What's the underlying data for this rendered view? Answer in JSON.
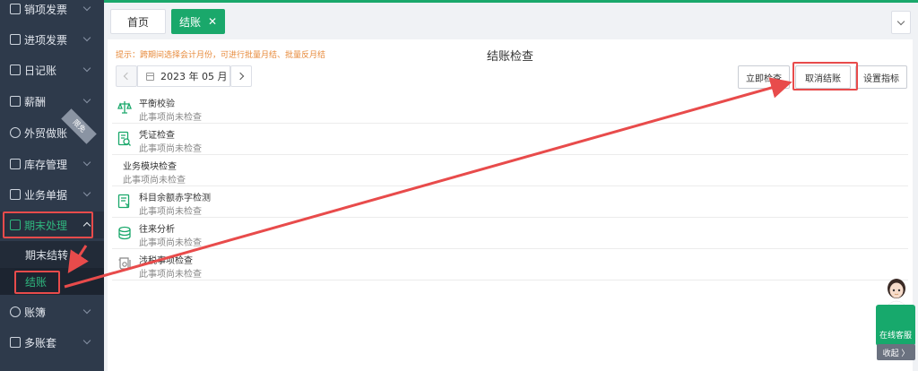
{
  "colors": {
    "brand": "#1aa86b",
    "sidebar": "#2e3a4b",
    "annotation": "#e84b4b",
    "tip": "#e78a3b"
  },
  "sidebar": {
    "items": [
      {
        "label": "销项发票",
        "icon": "invoice-icon"
      },
      {
        "label": "进项发票",
        "icon": "invoice-icon"
      },
      {
        "label": "日记账",
        "icon": "ledger-icon"
      },
      {
        "label": "薪酬",
        "icon": "salary-icon"
      },
      {
        "label": "外贸做账",
        "icon": "globe-icon",
        "badge": "限免"
      },
      {
        "label": "库存管理",
        "icon": "warehouse-icon"
      },
      {
        "label": "业务单据",
        "icon": "document-icon"
      },
      {
        "label": "期末处理",
        "icon": "period-end-icon",
        "expanded": true
      },
      {
        "label": "账簿",
        "icon": "yen-icon"
      },
      {
        "label": "多账套",
        "icon": "books-icon"
      }
    ],
    "sub_items": [
      {
        "label": "期末结转"
      },
      {
        "label": "结账",
        "selected": true
      }
    ]
  },
  "tabs": [
    {
      "label": "首页"
    },
    {
      "label": "结账",
      "close": "✕",
      "active": true
    }
  ],
  "main": {
    "title": "结账检查",
    "tip": "提示：跨期间选择会计月份，可进行批量月结、批量反月结",
    "period": "2023 年 05 月",
    "buttons": {
      "check_now": "立即检查",
      "cancel_close": "取消结账",
      "set_indicators": "设置指标"
    },
    "checks": [
      {
        "name": "平衡校验",
        "status": "此事项尚未检查",
        "icon": "balance-scale-icon"
      },
      {
        "name": "凭证检查",
        "status": "此事项尚未检查",
        "icon": "voucher-search-icon"
      },
      {
        "name": "业务模块检查",
        "status": "此事项尚未检查",
        "icon": ""
      },
      {
        "name": "科目余额赤字检测",
        "status": "此事项尚未检查",
        "icon": "account-deficit-icon"
      },
      {
        "name": "往来分析",
        "status": "此事项尚未检查",
        "icon": "coins-icon"
      },
      {
        "name": "涉税事项检查",
        "status": "此事项尚未检查",
        "icon": "tax-scroll-icon"
      }
    ]
  },
  "support": {
    "label": "在线客服",
    "collapse": "收起 〉"
  }
}
